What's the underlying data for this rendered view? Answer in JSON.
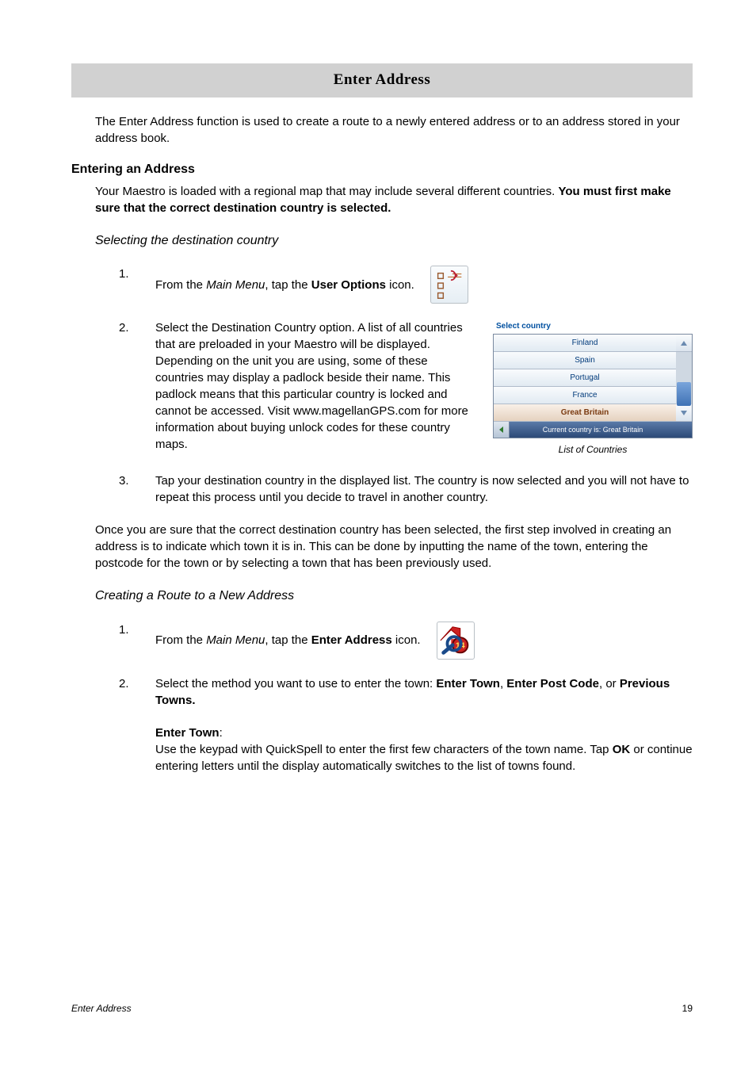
{
  "title": "Enter Address",
  "intro": "The Enter Address function is used to create a route to a newly entered address or to an address stored in your address book.",
  "section1": {
    "heading": "Entering an Address",
    "p1_a": "Your Maestro is loaded with a regional map that may include several different countries. ",
    "p1_b": "You must first make sure that the correct destination country is selected."
  },
  "sub1": {
    "heading": "Selecting the destination country",
    "step1_a": "From the ",
    "step1_b": "Main Menu",
    "step1_c": ", tap the ",
    "step1_d": "User Options",
    "step1_e": " icon.",
    "step2": "Select the Destination Country option. A list of all countries that are preloaded in your Maestro will be displayed. Depending on the unit you are using, some of these countries may display a padlock beside their name. This padlock means that this particular country is locked and cannot be accessed. Visit www.magellanGPS.com for more information about buying unlock codes for these country maps.",
    "step3": "Tap your destination country in the displayed list. The country is now selected and you will not have to repeat this process until you decide to travel in another country."
  },
  "country_panel": {
    "title": "Select country",
    "rows": [
      "Finland",
      "Spain",
      "Portugal",
      "France",
      "Great Britain"
    ],
    "status": "Current country is: Great Britain",
    "caption": "List of Countries"
  },
  "bridge": "Once you are sure that the correct destination country has been selected,  the first step involved in creating an address is to indicate which town it is in.  This can be done by inputting the name of the town, entering the postcode for the town or by selecting a town that has been previously used.",
  "sub2": {
    "heading": "Creating a Route to a New Address",
    "step1_a": "From the ",
    "step1_b": "Main Menu",
    "step1_c": ", tap the ",
    "step1_d": "Enter Address",
    "step1_e": " icon.",
    "step2_a": "Select the method you want to use to enter the town: ",
    "step2_b": "Enter Town",
    "step2_c": ", ",
    "step2_d": "Enter Post Code",
    "step2_e": ", or ",
    "step2_f": "Previous Towns.",
    "et_label": "Enter Town",
    "et_colon": ":",
    "et_text_a": "Use the keypad with QuickSpell to enter the first few characters of the town name.  Tap ",
    "et_text_b": "OK",
    "et_text_c": " or continue entering letters until the display automatically switches to the list of towns found."
  },
  "footer": {
    "left": "Enter Address",
    "right": "19"
  }
}
